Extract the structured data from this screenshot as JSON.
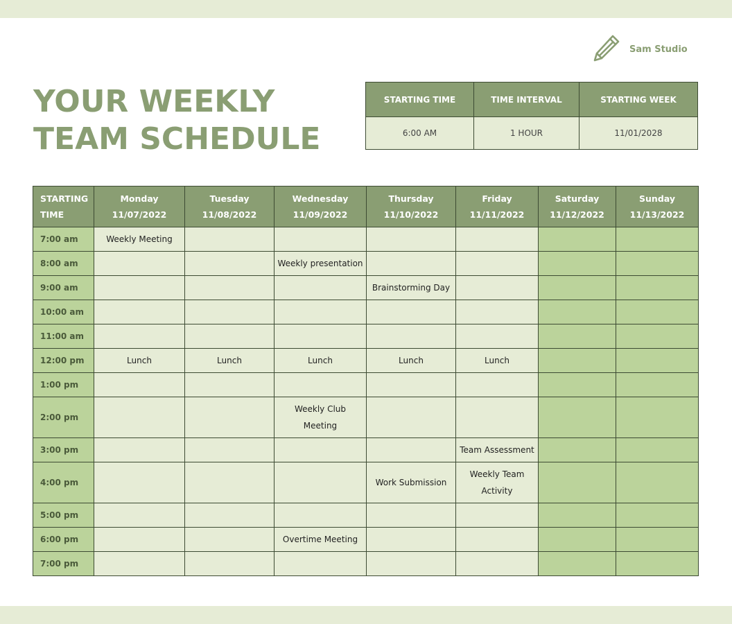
{
  "brand": {
    "name": "Sam Studio",
    "icon": "pencil-icon"
  },
  "title": {
    "line1": "YOUR WEEKLY",
    "line2": "TEAM SCHEDULE"
  },
  "info": {
    "headers": [
      "STARTING TIME",
      "TIME INTERVAL",
      "STARTING WEEK"
    ],
    "values": [
      "6:00 AM",
      "1 HOUR",
      "11/01/2028"
    ]
  },
  "schedule": {
    "corner": {
      "line1": "STARTING",
      "line2": "TIME"
    },
    "days": [
      {
        "name": "Monday",
        "date": "11/07/2022"
      },
      {
        "name": "Tuesday",
        "date": "11/08/2022"
      },
      {
        "name": "Wednesday",
        "date": "11/09/2022"
      },
      {
        "name": "Thursday",
        "date": "11/10/2022"
      },
      {
        "name": "Friday",
        "date": "11/11/2022"
      },
      {
        "name": "Saturday",
        "date": "11/12/2022"
      },
      {
        "name": "Sunday",
        "date": "11/13/2022"
      }
    ],
    "rows": [
      {
        "time": "7:00 am",
        "cells": [
          "Weekly Meeting",
          "",
          "",
          "",
          "",
          "",
          ""
        ]
      },
      {
        "time": "8:00 am",
        "cells": [
          "",
          "",
          "Weekly presentation",
          "",
          "",
          "",
          ""
        ]
      },
      {
        "time": "9:00 am",
        "cells": [
          "",
          "",
          "",
          "Brainstorming Day",
          "",
          "",
          ""
        ]
      },
      {
        "time": "10:00 am",
        "cells": [
          "",
          "",
          "",
          "",
          "",
          "",
          ""
        ]
      },
      {
        "time": "11:00 am",
        "cells": [
          "",
          "",
          "",
          "",
          "",
          "",
          ""
        ]
      },
      {
        "time": "12:00 pm",
        "cells": [
          "Lunch",
          "Lunch",
          "Lunch",
          "Lunch",
          "Lunch",
          "",
          ""
        ]
      },
      {
        "time": "1:00 pm",
        "cells": [
          "",
          "",
          "",
          "",
          "",
          "",
          ""
        ]
      },
      {
        "time": "2:00 pm",
        "cells": [
          "",
          "",
          "Weekly Club\nMeeting",
          "",
          "",
          "",
          ""
        ]
      },
      {
        "time": "3:00 pm",
        "cells": [
          "",
          "",
          "",
          "",
          "Team Assessment",
          "",
          ""
        ]
      },
      {
        "time": "4:00 pm",
        "cells": [
          "",
          "",
          "",
          "Work Submission",
          "Weekly Team\nActivity",
          "",
          ""
        ]
      },
      {
        "time": "5:00 pm",
        "cells": [
          "",
          "",
          "",
          "",
          "",
          "",
          ""
        ]
      },
      {
        "time": "6:00 pm",
        "cells": [
          "",
          "",
          "Overtime Meeting",
          "",
          "",
          "",
          ""
        ]
      },
      {
        "time": "7:00 pm",
        "cells": [
          "",
          "",
          "",
          "",
          "",
          "",
          ""
        ]
      }
    ]
  },
  "colors": {
    "accent": "#8a9e73",
    "header_bg": "#8a9e73",
    "cell_bg": "#e6ecd6",
    "weekend_bg": "#bbd39b",
    "border": "#3c4a32"
  }
}
